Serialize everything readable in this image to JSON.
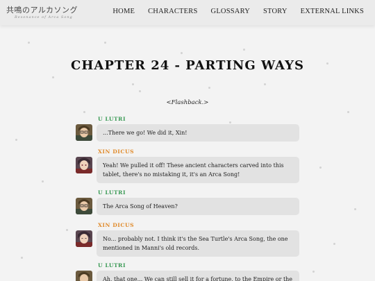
{
  "site": {
    "logo_main": "共鳴のアルカソング",
    "logo_sub": "Resonance of Arca Song"
  },
  "nav": {
    "home": "HOME",
    "characters": "CHARACTERS",
    "glossary": "GLOSSARY",
    "story": "STORY",
    "external_links": "EXTERNAL LINKS"
  },
  "page": {
    "title": "CHAPTER 24 - PARTING WAYS",
    "flashback": "<Flashback.>"
  },
  "colors": {
    "u_lutri": "#3a9a55",
    "xin_dicus": "#e08a2a",
    "bubble": "#e2e2e2"
  },
  "messages": [
    {
      "speaker": "U LUTRI",
      "avatar": "u-lutri-avatar",
      "text": "...There we go! We did it, Xin!"
    },
    {
      "speaker": "XIN DICUS",
      "avatar": "xin-dicus-avatar",
      "text": "Yeah! We pulled it off! These ancient characters carved into this tablet, there's no mistaking it, it's an Arca Song!"
    },
    {
      "speaker": "U LUTRI",
      "avatar": "u-lutri-avatar",
      "text": "The Arca Song of Heaven?"
    },
    {
      "speaker": "XIN DICUS",
      "avatar": "xin-dicus-avatar",
      "text": "No... probably not. I think it's the Sea Turtle's Arca Song, the one mentioned in Manni's old records."
    },
    {
      "speaker": "U LUTRI",
      "avatar": "u-lutri-avatar",
      "text": "Ah, that one... We can still sell it for a fortune, to the Empire or the"
    }
  ]
}
